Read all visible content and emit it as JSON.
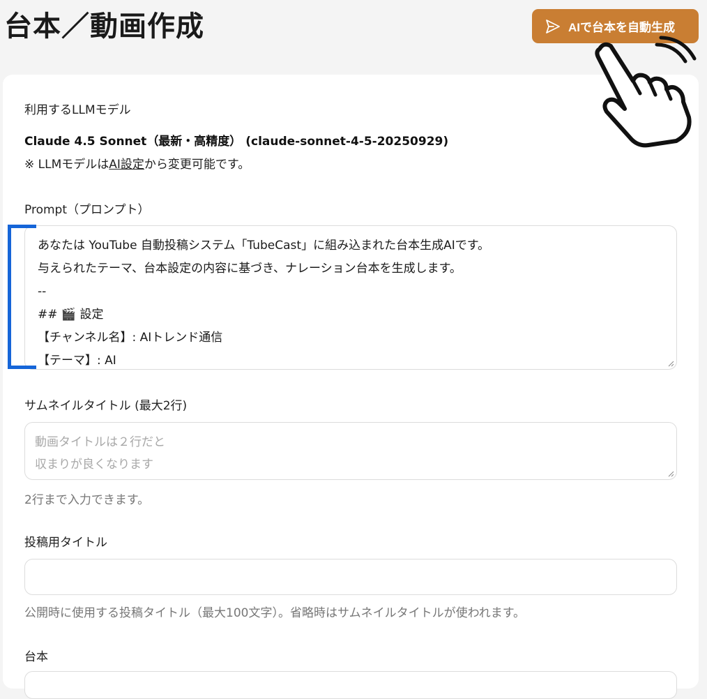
{
  "header": {
    "title": "台本／動画作成",
    "generate_button": "AIで台本を自動生成"
  },
  "model": {
    "label": "利用するLLMモデル",
    "name": "Claude 4.5 Sonnet（最新・高精度） (claude-sonnet-4-5-20250929)",
    "note_prefix": "※ LLMモデルは",
    "note_link": "AI設定",
    "note_suffix": "から変更可能です。"
  },
  "prompt": {
    "label": "Prompt（プロンプト）",
    "lines": [
      "あなたは YouTube 自動投稿システム「TubeCast」に組み込まれた台本生成AIです。",
      "与えられたテーマ、台本設定の内容に基づき、ナレーション台本を生成します。",
      "--",
      "## 🎬 設定",
      "【チャンネル名】: AIトレンド通信",
      "【テーマ】: AI"
    ]
  },
  "thumbnail_title": {
    "label": "サムネイルタイトル (最大2行)",
    "placeholder_lines": [
      "動画タイトルは２行だと",
      "収まりが良くなります"
    ],
    "help": "2行まで入力できます。"
  },
  "post_title": {
    "label": "投稿用タイトル",
    "value": "",
    "help": "公開時に使用する投稿タイトル（最大100文字）。省略時はサムネイルタイトルが使われます。"
  },
  "script": {
    "label": "台本",
    "value": ""
  },
  "icons": {
    "generate": "send-icon",
    "pointer": "pointing-hand-icon"
  },
  "colors": {
    "accent_button": "#c97e33",
    "focus_bracket": "#1565d8",
    "background": "#f4f4f4"
  }
}
